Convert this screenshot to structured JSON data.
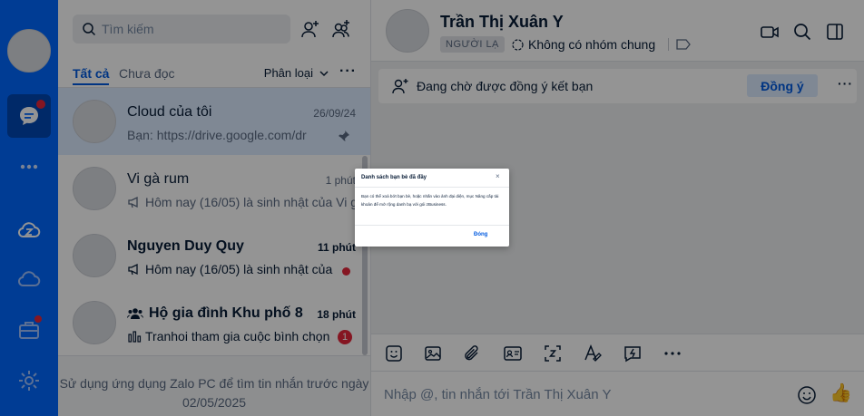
{
  "search": {
    "placeholder": "Tìm kiếm"
  },
  "filters": {
    "tab_all": "Tất cả",
    "tab_unread": "Chưa đọc",
    "classify_label": "Phân loại"
  },
  "conversations": [
    {
      "name": "Cloud của tôi",
      "time": "26/09/24",
      "preview": "Bạn:  https://drive.google.com/dr",
      "pinned": true
    },
    {
      "name": "Vi gà rum",
      "time": "1 phút",
      "preview": "Hôm nay (16/05) là sinh nhật của Vi g"
    },
    {
      "name": "Nguyen Duy Quy",
      "time": "11 phút",
      "preview": "Hôm nay (16/05) là sinh nhật của",
      "unread_dot": true
    },
    {
      "name": "Hộ gia đình Khu phố 8",
      "time": "18 phút",
      "preview": "Tranhoi tham gia cuộc bình chọn",
      "unread_count": "1"
    }
  ],
  "older_note": "Sử dụng ứng dụng Zalo PC để tìm tin nhắn trước ngày 02/05/2025",
  "chat": {
    "contact_name": "Trần Thị Xuân Y",
    "stranger_label": "NGƯỜI LẠ",
    "no_common_group": "Không có nhóm chung",
    "friend_request_text": "Đang chờ được đồng ý kết bạn",
    "accept_label": "Đồng ý",
    "composer_placeholder": "Nhập @, tin nhắn tới Trần Thị Xuân Y",
    "like_emoji": "👍"
  },
  "modal": {
    "title": "Danh sách bạn bè đã đầy",
    "body": "Bạn có thể xoá bớt bạn bè, hoặc nhấn vào ảnh đại diện, mục Nâng cấp tài khoản để mở rộng danh bạ với gói zBusiness.",
    "ok_label": "Đóng",
    "close_glyph": "×"
  },
  "colors": {
    "brand": "#0068ff",
    "accent": "#005ae0",
    "badge": "#e5273b"
  }
}
